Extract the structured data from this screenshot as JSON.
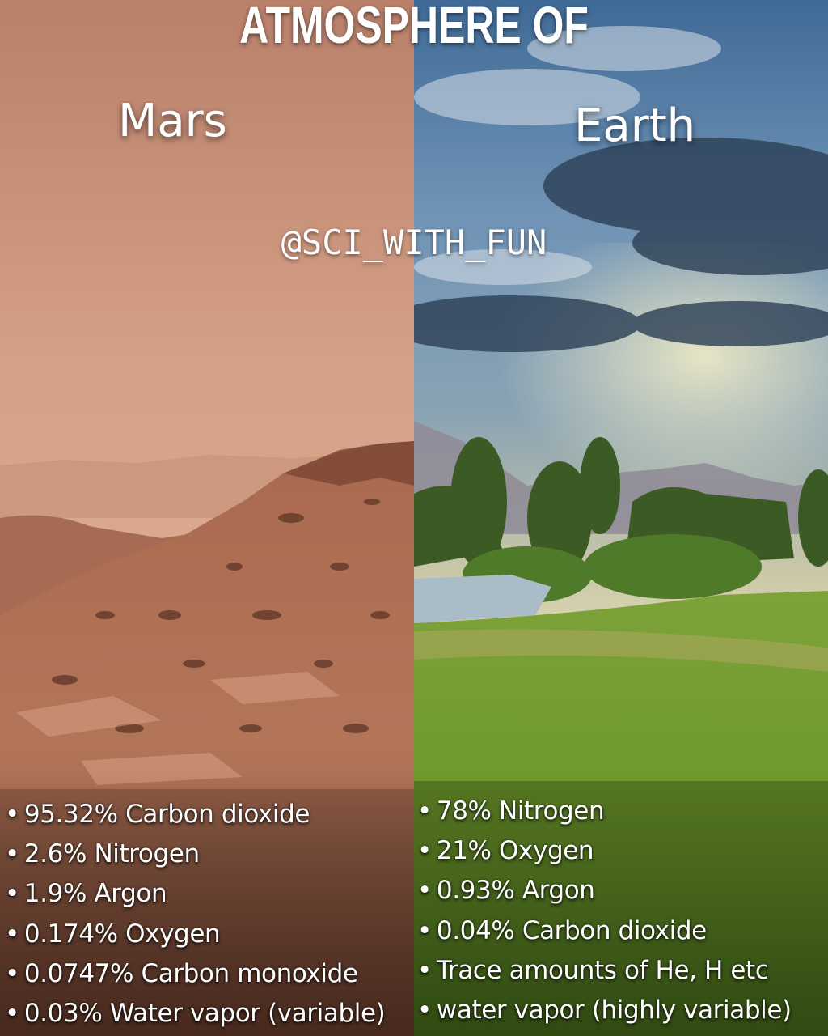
{
  "header": {
    "title": "ATMOSPHERE OF"
  },
  "watermark": "@SCI_WITH_FUN",
  "mars": {
    "label": "Mars",
    "facts": [
      "95.32% Carbon dioxide",
      "2.6% Nitrogen",
      "1.9% Argon",
      "0.174% Oxygen",
      "0.0747% Carbon monoxide",
      "0.03% Water vapor (variable)"
    ]
  },
  "earth": {
    "label": "Earth",
    "facts": [
      "78% Nitrogen",
      "21% Oxygen",
      "0.93% Argon",
      "0.04% Carbon dioxide",
      "Trace amounts of He, H etc",
      "water vapor (highly variable)"
    ]
  },
  "colors": {
    "mars_sky": "#d9a88a",
    "mars_ground": "#b07256",
    "earth_sky": "#4a6f95",
    "earth_grass": "#6f9a2c",
    "text": "#ffffff"
  }
}
